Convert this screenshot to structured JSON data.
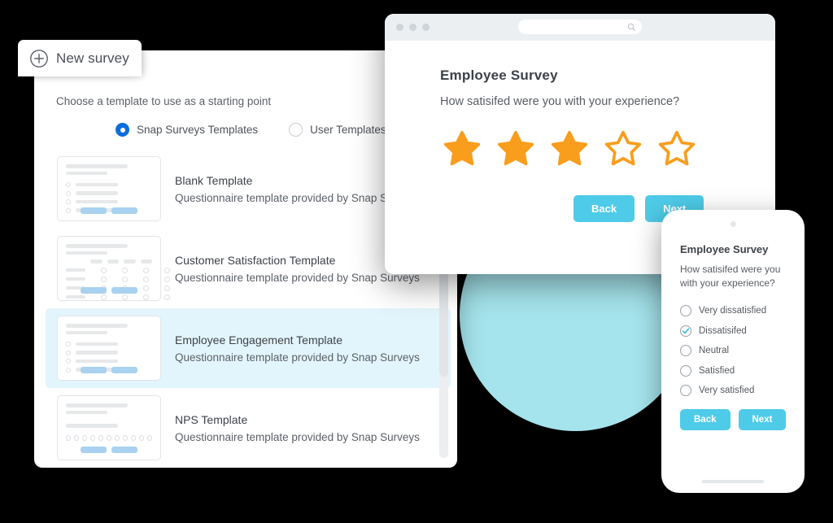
{
  "colors": {
    "accent_blue": "#0b6ddd",
    "button_cyan": "#4ecbe8",
    "star_orange": "#f99d1c",
    "selected_row_bg": "#e3f5fc",
    "teal_circle": "#a5e4ec",
    "thumb_button_blue": "#a8d2f0"
  },
  "new_survey_tab": {
    "label": "New survey",
    "icon": "plus-circle-icon"
  },
  "template_picker": {
    "instruction": "Choose a template to use as a starting point",
    "source_options": [
      {
        "label": "Snap Surveys Templates",
        "selected": true
      },
      {
        "label": "User Templates",
        "selected": false
      }
    ],
    "templates": [
      {
        "name": "Blank Template",
        "description": "Questionnaire template provided by Snap Su",
        "thumb": "list",
        "selected": false
      },
      {
        "name": "Customer Satisfaction Template",
        "description": "Questionnaire template provided by Snap Surveys",
        "thumb": "matrix",
        "selected": false
      },
      {
        "name": "Employee Engagement Template",
        "description": "Questionnaire template provided by Snap Surveys",
        "thumb": "list",
        "selected": true
      },
      {
        "name": "NPS Template",
        "description": "Questionnaire template provided by Snap Surveys",
        "thumb": "nps",
        "selected": false
      }
    ]
  },
  "browser_preview": {
    "window_controls": [
      "close-dot",
      "minimize-dot",
      "maximize-dot"
    ],
    "url_bar": {
      "value": "",
      "placeholder": "",
      "icon": "search-icon"
    },
    "survey": {
      "title": "Employee Survey",
      "question": "How satisifed were you with your experience?",
      "rating": {
        "type": "stars",
        "max": 5,
        "value": 3
      },
      "back_label": "Back",
      "next_label": "Next"
    }
  },
  "phone_preview": {
    "camera": "camera-dot",
    "survey": {
      "title": "Employee Survey",
      "question": "How satisifed were you with your experience?",
      "options": [
        {
          "label": "Very dissatisfied",
          "selected": false
        },
        {
          "label": "Dissatisifed",
          "selected": true
        },
        {
          "label": "Neutral",
          "selected": false
        },
        {
          "label": "Satisfied",
          "selected": false
        },
        {
          "label": "Very satisfied",
          "selected": false
        }
      ],
      "back_label": "Back",
      "next_label": "Next"
    }
  }
}
